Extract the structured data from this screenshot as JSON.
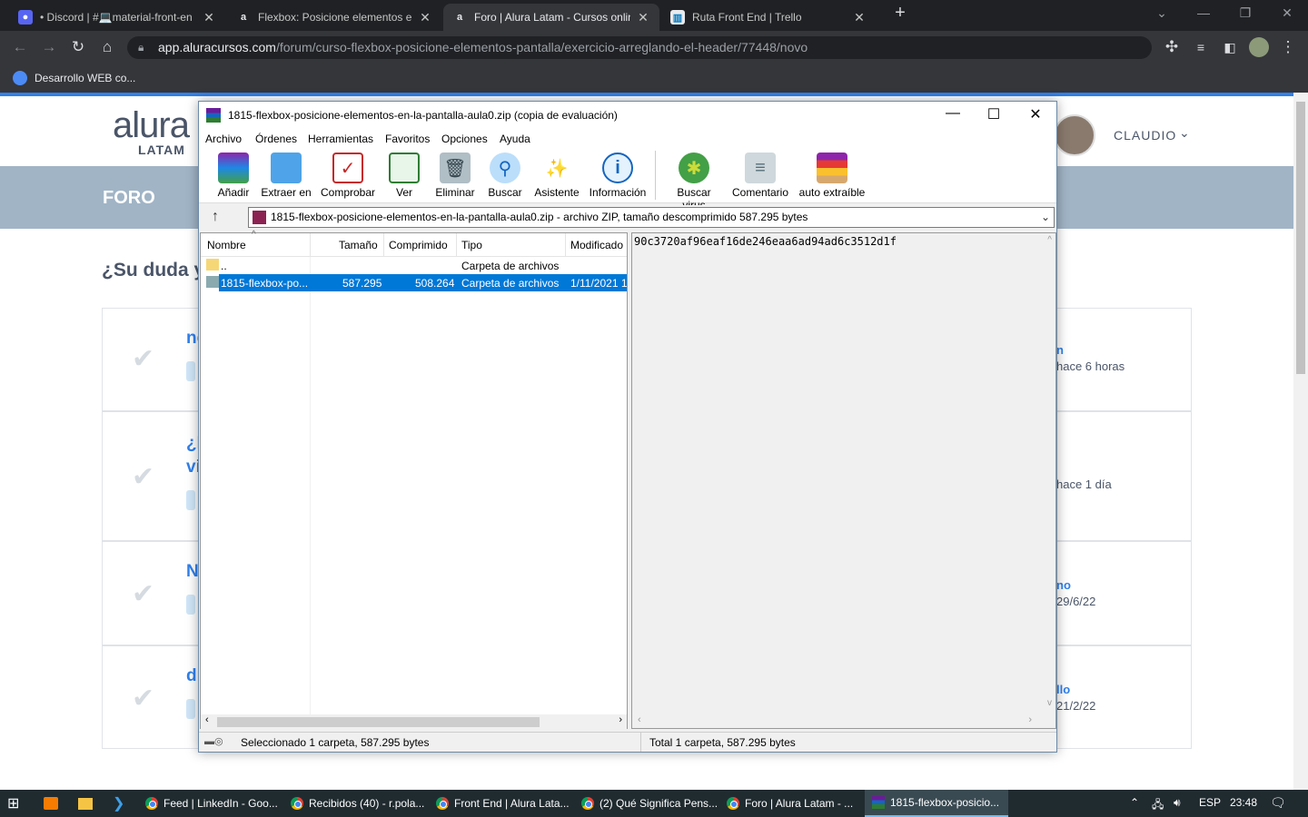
{
  "browser": {
    "tabs": [
      {
        "title": "• Discord | #💻material-front-en",
        "icon": "discord-icon"
      },
      {
        "title": "Flexbox: Posicione elementos en",
        "icon": "alura-icon"
      },
      {
        "title": "Foro | Alura Latam - Cursos onlin",
        "icon": "alura-icon",
        "active": true
      },
      {
        "title": "Ruta Front End | Trello",
        "icon": "trello-icon"
      }
    ],
    "url_domain": "app.aluracursos.com",
    "url_path": "/forum/curso-flexbox-posicione-elementos-pantalla/exercicio-arreglando-el-header/77448/novo",
    "bookmark": "Desarrollo WEB co..."
  },
  "site": {
    "logo_top": "alura",
    "logo_bottom": "LATAM",
    "user_name": "CLAUDIO",
    "section": "FORO",
    "heading": "¿Su duda y",
    "topics": [
      {
        "title": "nc",
        "title2": "",
        "author": "n",
        "time": "hace 6 horas"
      },
      {
        "title": "¿R",
        "title2": "vi",
        "author": "",
        "time": "hace 1 día"
      },
      {
        "title": "N",
        "title2": "",
        "author": "no",
        "time": "29/6/22"
      },
      {
        "title": "dı",
        "title2": "",
        "author": "llo",
        "time": "21/2/22"
      }
    ]
  },
  "winrar": {
    "title": "1815-flexbox-posicione-elementos-en-la-pantalla-aula0.zip (copia de evaluación)",
    "menu": [
      "Archivo",
      "Órdenes",
      "Herramientas",
      "Favoritos",
      "Opciones",
      "Ayuda"
    ],
    "toolbar": [
      "Añadir",
      "Extraer en",
      "Comprobar",
      "Ver",
      "Eliminar",
      "Buscar",
      "Asistente",
      "Información",
      "Buscar virus",
      "Comentario",
      "auto extraíble"
    ],
    "address": "1815-flexbox-posicione-elementos-en-la-pantalla-aula0.zip - archivo ZIP, tamaño descomprimido 587.295 bytes",
    "columns": [
      "Nombre",
      "Tamaño",
      "Comprimido",
      "Tipo",
      "Modificado"
    ],
    "rows": [
      {
        "name": "..",
        "size": "",
        "packed": "",
        "type": "Carpeta de archivos",
        "modified": ""
      },
      {
        "name": "1815-flexbox-po...",
        "size": "587.295",
        "packed": "508.264",
        "type": "Carpeta de archivos",
        "modified": "1/11/2021 1"
      }
    ],
    "hash": "90c3720af96eaf16de246eaa6ad94ad6c3512d1f",
    "status_left": "Seleccionado 1 carpeta, 587.295 bytes",
    "status_right": "Total 1 carpeta, 587.295 bytes"
  },
  "taskbar": {
    "items": [
      "Feed | LinkedIn - Goo...",
      "Recibidos (40) - r.pola...",
      "Front End | Alura Lata...",
      "(2) Qué Significa Pens...",
      "Foro | Alura Latam - ...",
      "1815-flexbox-posicio..."
    ],
    "lang": "ESP",
    "time": "23:48"
  }
}
